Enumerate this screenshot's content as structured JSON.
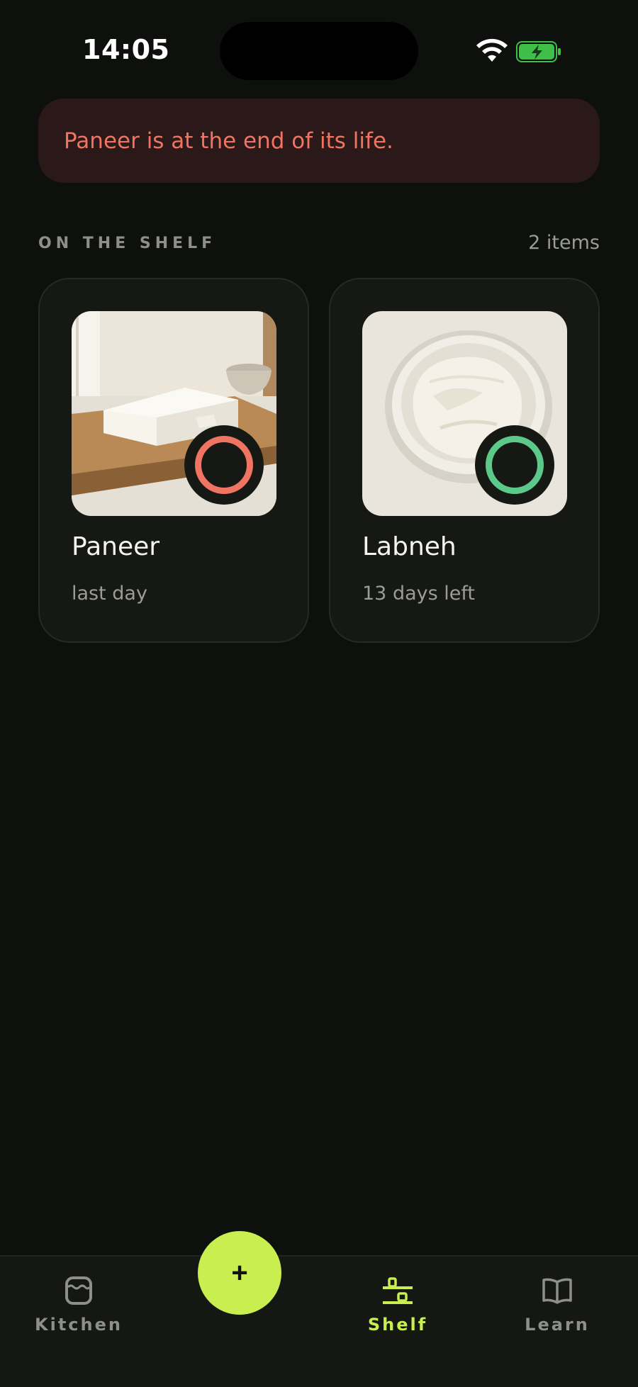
{
  "status_bar": {
    "time": "14:05"
  },
  "alert": {
    "message": "Paneer is at the end of its life.",
    "color": "#ef7462"
  },
  "shelf": {
    "title": "ON THE SHELF",
    "count": "2 items",
    "items": [
      {
        "name": "Paneer",
        "status": "last day",
        "ring_color": "#ef7462",
        "photo": "paneer block on cutting board"
      },
      {
        "name": "Labneh",
        "status": "13 days left",
        "ring_color": "#5cc98a",
        "photo": "bowl of labneh"
      }
    ]
  },
  "fab": {
    "label": "+"
  },
  "nav": {
    "items": [
      {
        "label": "Kitchen",
        "icon": "fridge-icon",
        "active": false
      },
      {
        "label": "Shelf",
        "icon": "shelf-icon",
        "active": true
      },
      {
        "label": "Learn",
        "icon": "book-icon",
        "active": false
      }
    ],
    "accent": "#c8ef4f"
  }
}
